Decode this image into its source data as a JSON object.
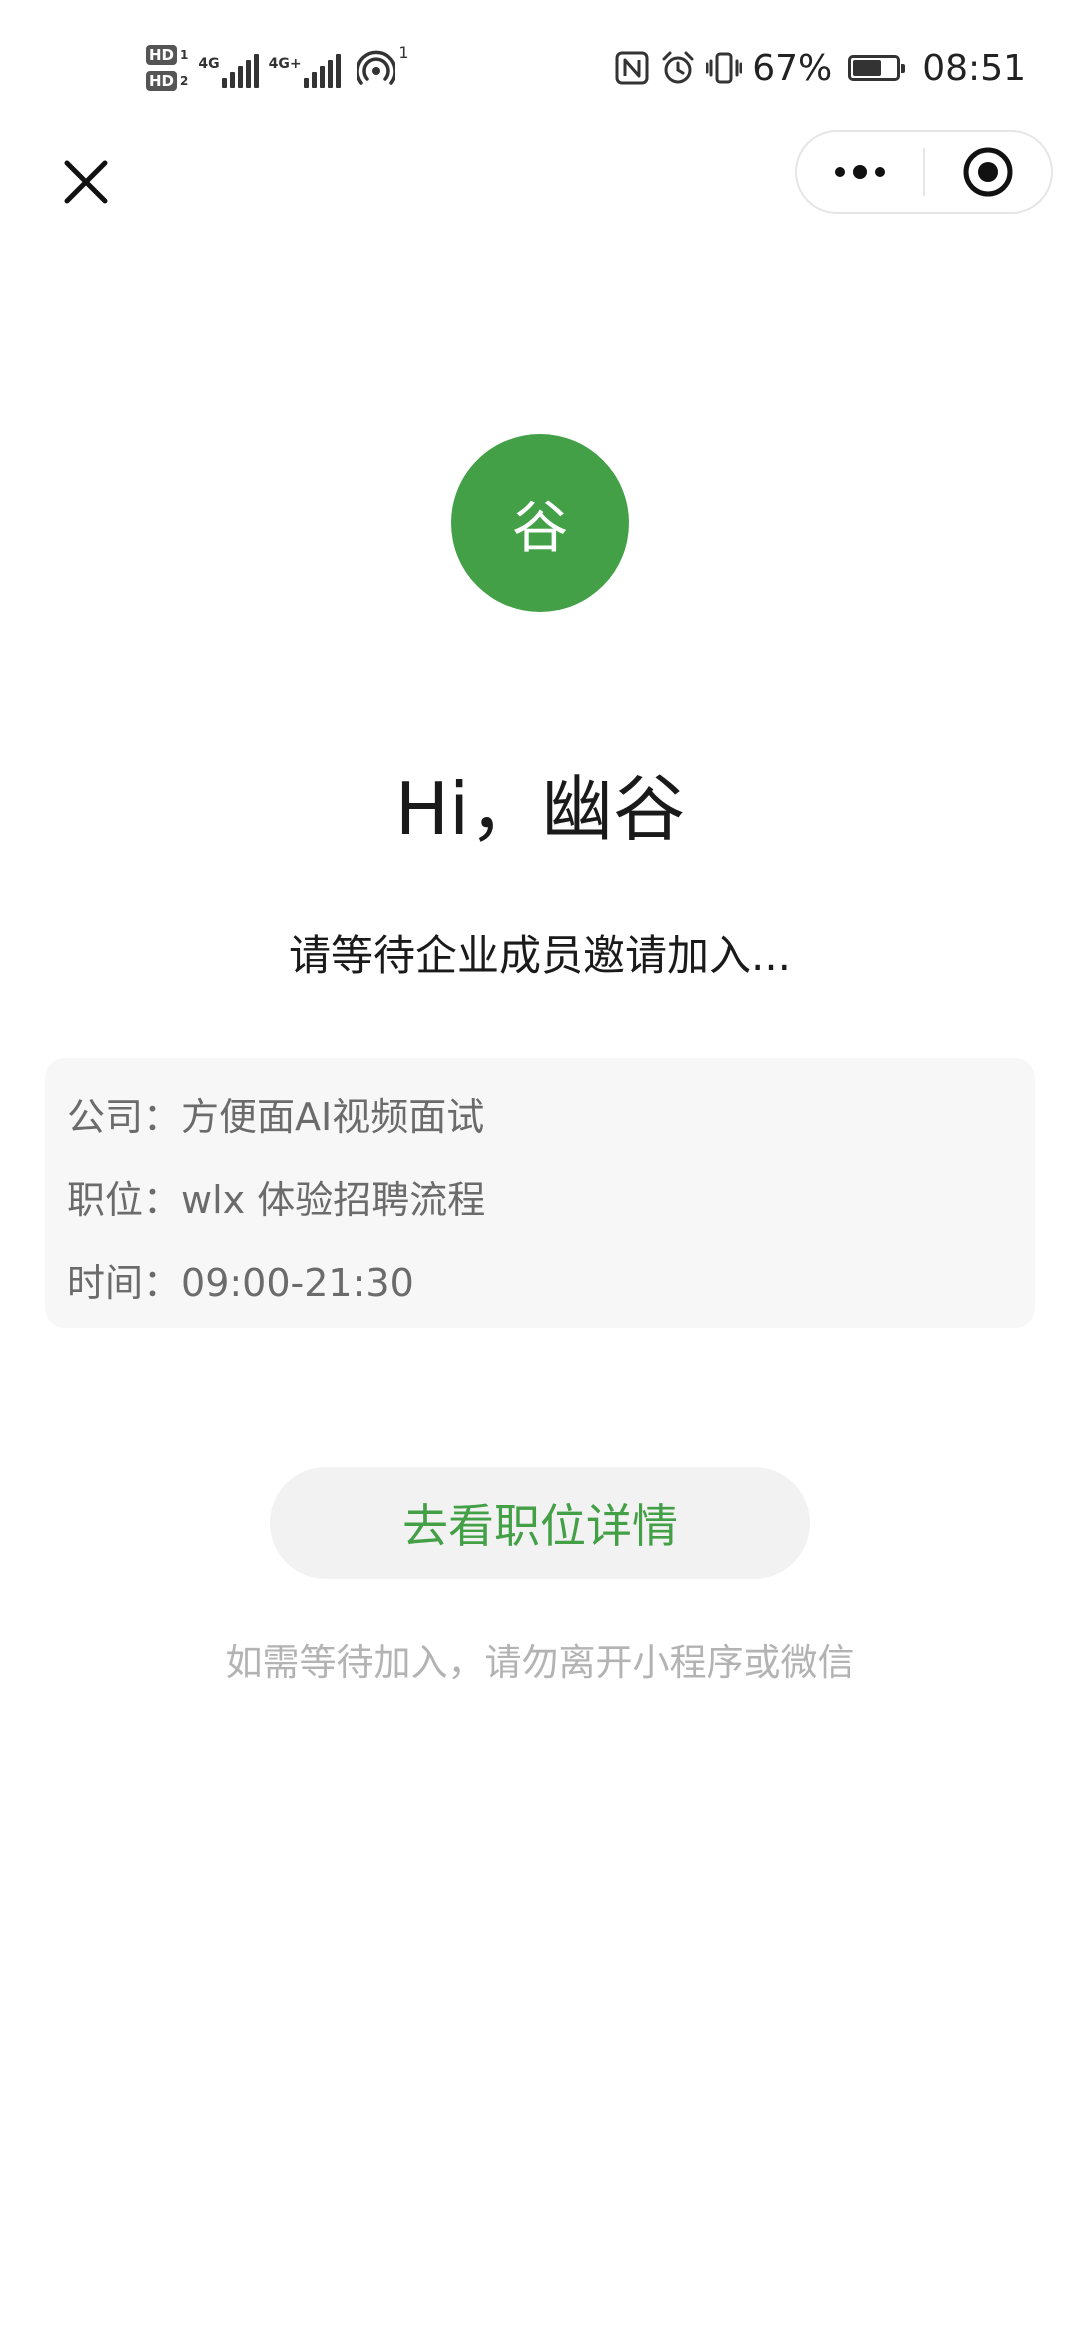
{
  "status_bar": {
    "hd1": "HD",
    "hd1_num": "1",
    "hd2": "HD",
    "hd2_num": "2",
    "net1": "4G",
    "net2": "4G+",
    "hotspot_count": "1",
    "battery_percent": "67%",
    "battery_level": 0.67,
    "time": "08:51",
    "icons": [
      "nfc-icon",
      "alarm-icon",
      "vibrate-icon",
      "battery-icon"
    ]
  },
  "nav": {
    "close_icon": "close-icon",
    "more_icon": "more-dots-icon",
    "exit_icon": "target-circle-icon"
  },
  "avatar": {
    "initial": "谷",
    "color": "#43a047"
  },
  "greeting": "Hi，幽谷",
  "waiting_message": "请等待企业成员邀请加入...",
  "info": {
    "company_label": "公司：",
    "company_value": "方便面AI视频面试",
    "position_label": "职位：",
    "position_value": "wlx 体验招聘流程",
    "time_label": "时间：",
    "time_value": "09:00-21:30"
  },
  "detail_button": "去看职位详情",
  "hint": "如需等待加入，请勿离开小程序或微信",
  "colors": {
    "accent": "#43a047",
    "card_bg": "#f7f7f7",
    "hint_text": "#b3b3b3"
  }
}
